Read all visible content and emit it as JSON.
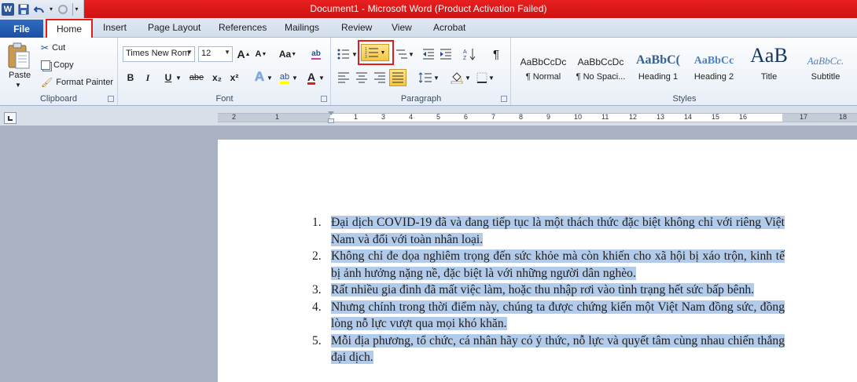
{
  "window": {
    "title": "Document1 - Microsoft Word (Product Activation Failed)"
  },
  "qat": {
    "app_icon": "W"
  },
  "tabs": {
    "file": "File",
    "home": "Home",
    "others": [
      "Insert",
      "Page Layout",
      "References",
      "Mailings",
      "Review",
      "View",
      "Acrobat"
    ]
  },
  "clipboard": {
    "paste": "Paste",
    "cut": "Cut",
    "copy": "Copy",
    "format_painter": "Format Painter",
    "label": "Clipboard"
  },
  "font": {
    "family": "Times New Rom",
    "size": "12",
    "label": "Font",
    "bold": "B",
    "italic": "I",
    "underline": "U",
    "strike": "abe",
    "subscript": "x₂",
    "superscript": "x²",
    "grow": "A",
    "shrink": "A",
    "change_case": "Aa",
    "font_color_letter": "A"
  },
  "paragraph": {
    "label": "Paragraph",
    "pilcrow": "¶"
  },
  "styles": {
    "label": "Styles",
    "items": [
      {
        "sample": "AaBbCcDc",
        "name": "¶ Normal"
      },
      {
        "sample": "AaBbCcDc",
        "name": "¶ No Spaci..."
      },
      {
        "sample": "AaBbC(",
        "name": "Heading 1"
      },
      {
        "sample": "AaBbCc",
        "name": "Heading 2"
      },
      {
        "sample": "AaB",
        "name": "Title"
      },
      {
        "sample": "AaBbCc.",
        "name": "Subtitle"
      }
    ]
  },
  "ruler": {
    "numbers": [
      "2",
      "1",
      "1",
      "2",
      "3",
      "4",
      "5",
      "6",
      "7",
      "8",
      "9",
      "10",
      "11",
      "12",
      "13",
      "14",
      "15",
      "16",
      "17",
      "18"
    ]
  },
  "document": {
    "items": [
      {
        "num": "1.",
        "text": "Đại dịch COVID-19 đã và đang tiếp tục là một thách thức đặc biệt không chỉ với riêng Việt Nam và đối với toàn nhân loại."
      },
      {
        "num": "2.",
        "text": "Không chỉ đe dọa nghiêm trọng đến sức khỏe mà còn khiến cho xã hội bị xáo trộn, kinh tế bị ảnh hưởng nặng nề, đặc biệt là với những người dân nghèo."
      },
      {
        "num": "3.",
        "text": "Rất nhiều gia đình đã mất việc làm, hoặc thu nhập rơi vào tình trạng hết sức bấp bênh."
      },
      {
        "num": "4.",
        "text": "Nhưng chính trong thời điểm này, chúng ta được chứng kiến một Việt Nam đồng sức, đồng lòng nỗ lực vượt qua mọi khó khăn."
      },
      {
        "num": "5.",
        "text": "Mỗi địa phương, tổ chức, cá nhân hãy có ý thức, nỗ lực và quyết tâm cùng nhau chiến thắng đại dịch."
      }
    ]
  }
}
